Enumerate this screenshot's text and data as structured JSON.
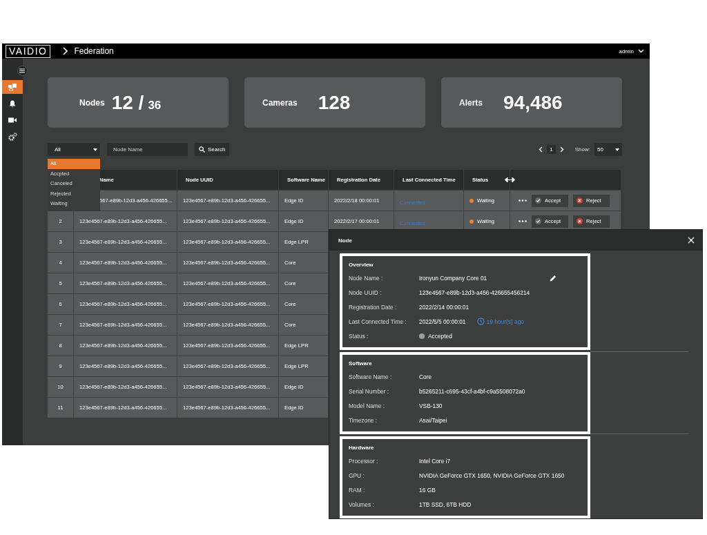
{
  "app": {
    "logo": "VAIDIO",
    "breadcrumb": "Federation",
    "user": "admin"
  },
  "sidebar": [
    {
      "kind": "nodes",
      "selected": true
    },
    {
      "kind": "alerts",
      "selected": false
    },
    {
      "kind": "cameras",
      "selected": false
    },
    {
      "kind": "settings",
      "selected": false
    }
  ],
  "stats": [
    {
      "label": "Nodes",
      "value": "12 /",
      "sub": "36"
    },
    {
      "label": "Cameras",
      "value": "128"
    },
    {
      "label": "Alerts",
      "value": "94,486"
    }
  ],
  "filter": {
    "value": "All",
    "options": [
      {
        "label": "All",
        "selected": true
      },
      {
        "label": "Accpted",
        "selected": false
      },
      {
        "label": "Canceled",
        "selected": false
      },
      {
        "label": "Rejected",
        "selected": false
      },
      {
        "label": "Waiting",
        "selected": false
      }
    ]
  },
  "search": {
    "placeholder": "Node Name",
    "button": "Search"
  },
  "pagination": {
    "page": "1",
    "show_label": "Show:",
    "show_value": "50"
  },
  "table": {
    "columns": [
      "Name",
      "Node UUID",
      "Software Name",
      "Registration Date",
      "Last Connected Time",
      "Status"
    ],
    "rows": [
      {
        "name": "567-e89b-12d3-a456-426655...",
        "uuid": "123e4567-e89b-12d3-a456-426655...",
        "software": "Edge ID",
        "registered": "2022/2/18 00:00:01",
        "connection": "Connected",
        "status": "Waiting",
        "color": "#e8823a",
        "actions": [
          "Accept",
          "Reject"
        ]
      },
      {
        "number": "2",
        "name": "123e4567-e89b-12d3-a456-426655...",
        "uuid": "123e4567-e89b-12d3-a456-426655...",
        "software": "Edge ID",
        "registered": "2022/2/17 00:00:01",
        "connection": "Connected",
        "status": "Waiting",
        "color": "#e8823a",
        "actions": [
          "Accept",
          "Reject"
        ]
      },
      {
        "number": "3",
        "name": "123e4567-e89b-12d3-a456-426655...",
        "uuid": "123e4567-e89b-12d3-a456-426655...",
        "software": "Edge LPR"
      },
      {
        "number": "4",
        "name": "123e4567-e89b-12d3-a456-426655...",
        "uuid": "123e4567-e89b-12d3-a456-426655...",
        "software": "Core"
      },
      {
        "number": "5",
        "name": "123e4567-e89b-12d3-a456-426655...",
        "uuid": "123e4567-e89b-12d3-a456-426655...",
        "software": "Core"
      },
      {
        "number": "6",
        "name": "123e4567-e89b-12d3-a456-426655...",
        "uuid": "123e4567-e89b-12d3-a456-426655...",
        "software": "Core"
      },
      {
        "number": "7",
        "name": "123e4567-e89b-12d3-a456-426655...",
        "uuid": "123e4567-e89b-12d3-a456-426655...",
        "software": "Core"
      },
      {
        "number": "8",
        "name": "123e4567-e89b-12d3-a456-426655...",
        "uuid": "123e4567-e89b-12d3-a456-426655...",
        "software": "Edge LPR"
      },
      {
        "number": "9",
        "name": "123e4567-e89b-12d3-a456-426655...",
        "uuid": "123e4567-e89b-12d3-a456-426655...",
        "software": "Edge LPR"
      },
      {
        "number": "10",
        "name": "123e4567-e89b-12d3-a456-426655...",
        "uuid": "123e4567-e89b-12d3-a456-426655...",
        "software": "Edge ID"
      },
      {
        "number": "11",
        "name": "123e4567-e89b-12d3-a456-426655...",
        "uuid": "123e4567-e89b-12d3-a456-426655...",
        "software": "Edge ID"
      }
    ]
  },
  "dialog": {
    "title": "Node",
    "sections": [
      {
        "title": "Overview",
        "fields": [
          {
            "kind": "editable",
            "label": "Node Name :",
            "value": "Ironyun Company Core 01"
          },
          {
            "kind": "text",
            "label": "Node UUID :",
            "value": "123e4567-e89b-12d3-a456-426655456214"
          },
          {
            "kind": "text",
            "label": "Registration Date :",
            "value": "2022/2/14 00:00:01"
          },
          {
            "kind": "time",
            "label": "Last Connected Time :",
            "value": "2022/5/5 00:00:01",
            "note": "19 hour(s) ago"
          },
          {
            "kind": "status",
            "label": "Status :",
            "value": "Accepted",
            "color": "#9b9b9b"
          }
        ]
      },
      {
        "title": "Software",
        "fields": [
          {
            "kind": "text",
            "label": "Software Name :",
            "value": "Core"
          },
          {
            "kind": "text",
            "label": "Serial Number :",
            "value": "b5265211-c695-43cf-a4bf-c9a5508072a0"
          },
          {
            "kind": "text",
            "label": "Model Name :",
            "value": "VSB-130"
          },
          {
            "kind": "text",
            "label": "Timezone :",
            "value": "Asai/Taipei"
          }
        ]
      },
      {
        "title": "Hardware",
        "fields": [
          {
            "kind": "text",
            "label": "Processor :",
            "value": "Intel Core i7"
          },
          {
            "kind": "text",
            "label": "GPU :",
            "value": "NVIDIA GeForce GTX 1650, NVIDIA GeForce GTX 1650"
          },
          {
            "kind": "text",
            "label": "RAM :",
            "value": "16 GB"
          },
          {
            "kind": "text",
            "label": "Volumes :",
            "value": "1TB SSD, 6TB HDD"
          }
        ]
      }
    ]
  }
}
